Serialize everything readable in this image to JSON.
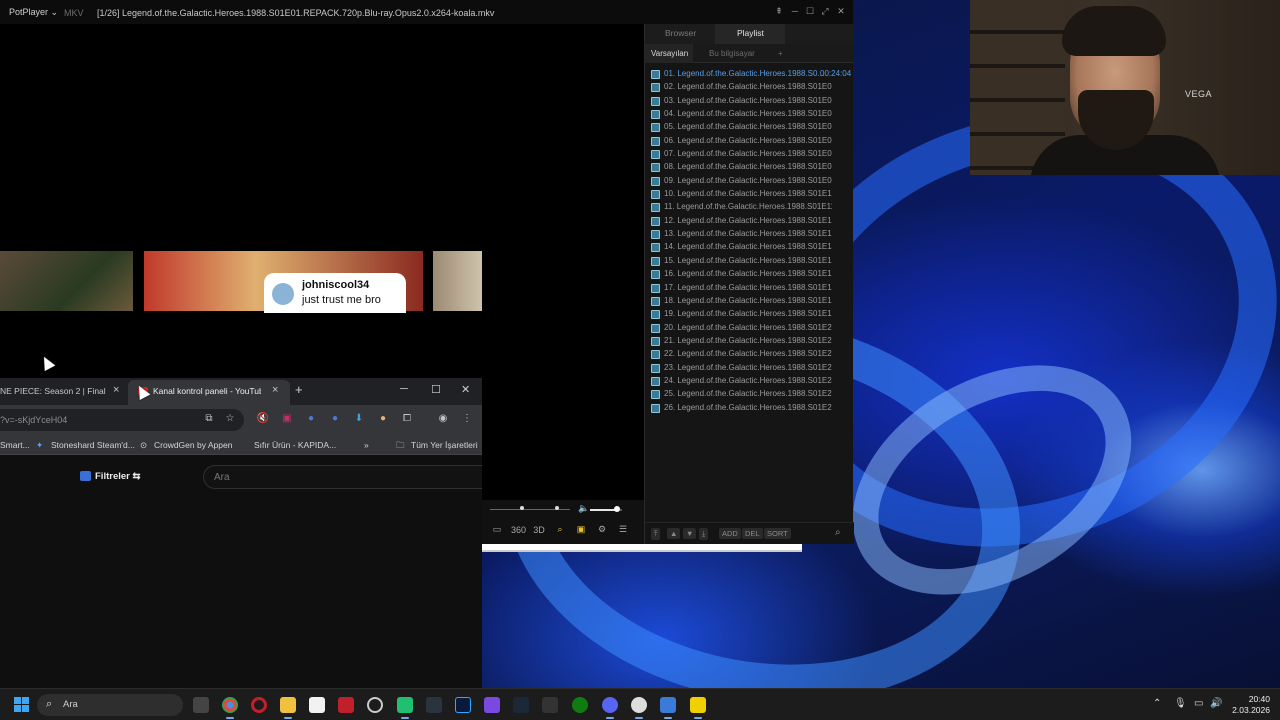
{
  "potplayer": {
    "brand": "PotPlayer ⌄",
    "format": "MKV",
    "title": "[1/26] Legend.of.the.Galactic.Heroes.1988.S01E01.REPACK.720p.Blu-ray.Opus2.0.x264-koala.mkv",
    "playlist": {
      "tabs": [
        "Browser",
        "Playlist"
      ],
      "subtabs": [
        "Varsayılan",
        "Bu bilgisayar",
        "+"
      ],
      "items": [
        {
          "label": "01. Legend.of.the.Galactic.Heroes.1988.S0...",
          "duration": "00:24:04"
        },
        {
          "label": "02. Legend.of.the.Galactic.Heroes.1988.S01E02.REP..."
        },
        {
          "label": "03. Legend.of.the.Galactic.Heroes.1988.S01E03.REP..."
        },
        {
          "label": "04. Legend.of.the.Galactic.Heroes.1988.S01E04.REP..."
        },
        {
          "label": "05. Legend.of.the.Galactic.Heroes.1988.S01E05.REP..."
        },
        {
          "label": "06. Legend.of.the.Galactic.Heroes.1988.S01E06.REP..."
        },
        {
          "label": "07. Legend.of.the.Galactic.Heroes.1988.S01E07.REP..."
        },
        {
          "label": "08. Legend.of.the.Galactic.Heroes.1988.S01E08.REP..."
        },
        {
          "label": "09. Legend.of.the.Galactic.Heroes.1988.S01E09.REP..."
        },
        {
          "label": "10. Legend.of.the.Galactic.Heroes.1988.S01E10.REP..."
        },
        {
          "label": "11. Legend.of.the.Galactic.Heroes.1988.S01E11.REP..."
        },
        {
          "label": "12. Legend.of.the.Galactic.Heroes.1988.S01E12.REP..."
        },
        {
          "label": "13. Legend.of.the.Galactic.Heroes.1988.S01E13.REP..."
        },
        {
          "label": "14. Legend.of.the.Galactic.Heroes.1988.S01E14.REP..."
        },
        {
          "label": "15. Legend.of.the.Galactic.Heroes.1988.S01E15.REP..."
        },
        {
          "label": "16. Legend.of.the.Galactic.Heroes.1988.S01E16.REP..."
        },
        {
          "label": "17. Legend.of.the.Galactic.Heroes.1988.S01E17.REP..."
        },
        {
          "label": "18. Legend.of.the.Galactic.Heroes.1988.S01E18.REP..."
        },
        {
          "label": "19. Legend.of.the.Galactic.Heroes.1988.S01E19.REP..."
        },
        {
          "label": "20. Legend.of.the.Galactic.Heroes.1988.S01E20.REP..."
        },
        {
          "label": "21. Legend.of.the.Galactic.Heroes.1988.S01E21.REP..."
        },
        {
          "label": "22. Legend.of.the.Galactic.Heroes.1988.S01E22.REP..."
        },
        {
          "label": "23. Legend.of.the.Galactic.Heroes.1988.S01E23.REP..."
        },
        {
          "label": "24. Legend.of.the.Galactic.Heroes.1988.S01E24.REP..."
        },
        {
          "label": "25. Legend.of.the.Galactic.Heroes.1988.S01E25.REP..."
        },
        {
          "label": "26. Legend.of.the.Galactic.Heroes.1988.S01E26.REP..."
        }
      ],
      "buttons": [
        "ADD",
        "DEL",
        "SORT"
      ]
    },
    "volume_level": 0.85
  },
  "chrome": {
    "tabs": [
      {
        "label": "NE PIECE: Season 2 | Final Tra"
      },
      {
        "label": "Kanal kontrol paneli - YouTube"
      }
    ],
    "new_tab": "+",
    "url": "?v=-sKjdYceH04",
    "bookmarks": [
      "Smart...",
      "Stoneshard Steam'd...",
      "CrowdGen by Appen",
      "Sıfır Ürün - KAPIDA...",
      "»",
      "Tüm Yer İşaretleri"
    ],
    "filters_label": "Filtreler",
    "search_placeholder": "Ara",
    "comment": {
      "user": "johniscool34",
      "text": "just trust me bro"
    }
  },
  "webcam": {
    "tag": "VEGA"
  },
  "taskbar": {
    "search_label": "Ara",
    "time": "20:40",
    "date": "2.03.2026"
  }
}
